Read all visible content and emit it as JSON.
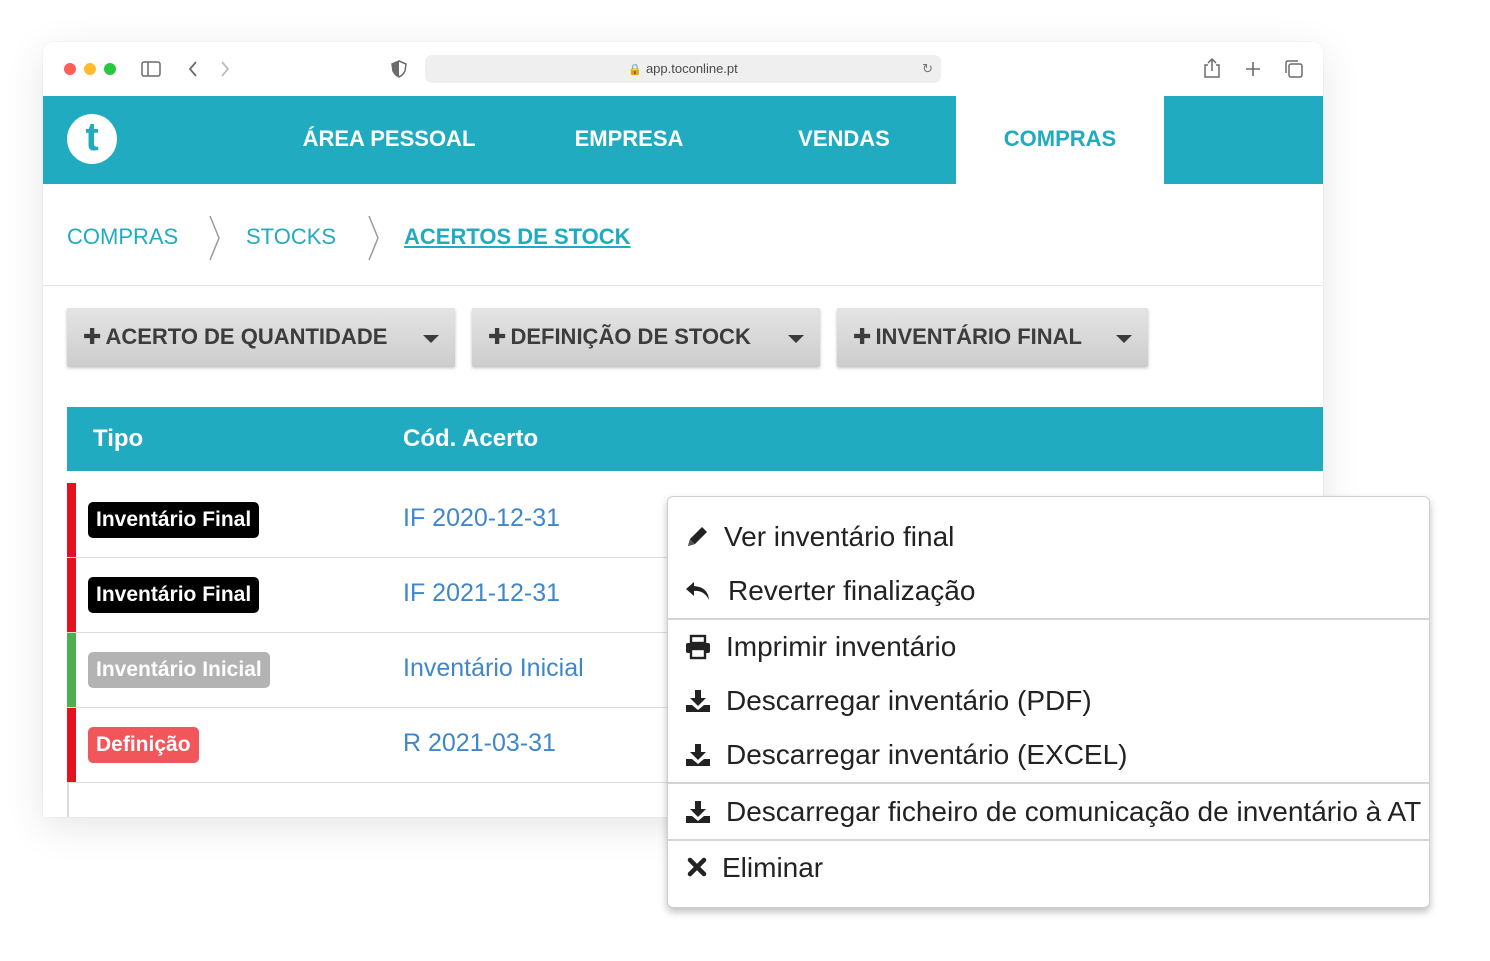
{
  "browser": {
    "url": "app.toconline.pt"
  },
  "nav": {
    "items": [
      {
        "label": "ÁREA PESSOAL"
      },
      {
        "label": "EMPRESA"
      },
      {
        "label": "VENDAS"
      },
      {
        "label": "COMPRAS",
        "active": true
      }
    ]
  },
  "breadcrumb": [
    "COMPRAS",
    "STOCKS",
    "ACERTOS DE STOCK"
  ],
  "actions": [
    {
      "label": "ACERTO DE QUANTIDADE"
    },
    {
      "label": "DEFINIÇÃO DE STOCK"
    },
    {
      "label": "INVENTÁRIO FINAL"
    }
  ],
  "table": {
    "columns": [
      "Tipo",
      "Cód. Acerto"
    ],
    "rows": [
      {
        "type": "Inventário Final",
        "code": "IF 2020-12-31",
        "status_color": "#e3121e",
        "badge_color": "#000000"
      },
      {
        "type": "Inventário Final",
        "code": "IF 2021-12-31",
        "status_color": "#e3121e",
        "badge_color": "#000000"
      },
      {
        "type": "Inventário Inicial",
        "code": "Inventário Inicial",
        "status_color": "#4caf50",
        "badge_color": "#b3b3b3"
      },
      {
        "type": "Definição",
        "code": "R 2021-03-31",
        "status_color": "#e3121e",
        "badge_color": "#f0565a"
      }
    ]
  },
  "context_menu": {
    "items": [
      {
        "label": "Ver inventário final",
        "icon": "pencil-icon"
      },
      {
        "label": "Reverter finalização",
        "icon": "undo-icon"
      },
      {
        "label": "Imprimir inventário",
        "icon": "print-icon"
      },
      {
        "label": "Descarregar inventário (PDF)",
        "icon": "download-icon"
      },
      {
        "label": "Descarregar inventário (EXCEL)",
        "icon": "download-icon"
      },
      {
        "label": "Descarregar ficheiro de comunicação de inventário à AT",
        "icon": "download-icon"
      },
      {
        "label": "Eliminar",
        "icon": "close-icon"
      }
    ]
  },
  "colors": {
    "brand": "#20abc1",
    "link": "#3f87c8"
  }
}
